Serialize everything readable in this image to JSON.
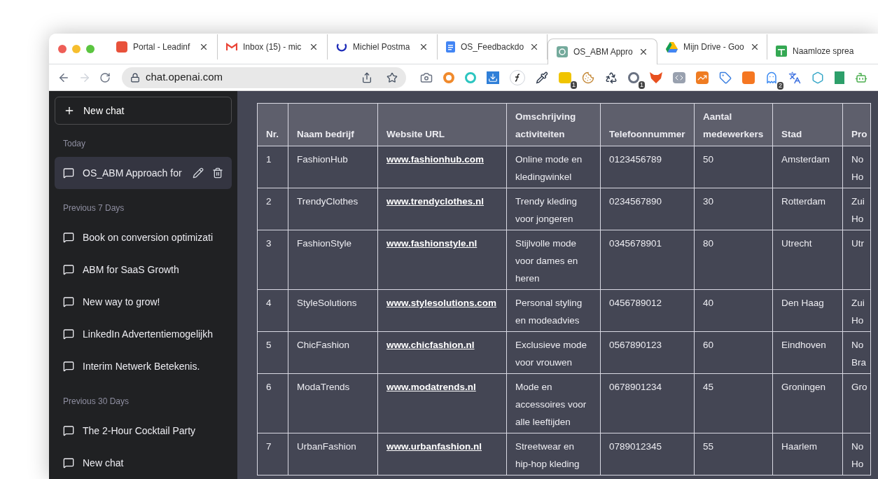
{
  "tabs": [
    {
      "title": "Portal - Leadinf",
      "selected": false
    },
    {
      "title": "Inbox (15) - mic",
      "selected": false
    },
    {
      "title": "Michiel Postma",
      "selected": false
    },
    {
      "title": "OS_Feedbackdo",
      "selected": false
    },
    {
      "title": "OS_ABM Appro",
      "selected": true
    },
    {
      "title": "Mijn Drive - Goo",
      "selected": false
    },
    {
      "title": "Naamloze sprea",
      "selected": false
    }
  ],
  "address": {
    "url": "chat.openai.com"
  },
  "extensions": [
    {
      "kind": "camera"
    },
    {
      "kind": "orange-ring"
    },
    {
      "kind": "teal-ring"
    },
    {
      "kind": "download"
    },
    {
      "kind": "formula"
    },
    {
      "kind": "dropper"
    },
    {
      "kind": "yellow",
      "badge": "1"
    },
    {
      "kind": "cookie"
    },
    {
      "kind": "recycle"
    },
    {
      "kind": "grey-ring",
      "badge": "1"
    },
    {
      "kind": "fox"
    },
    {
      "kind": "code"
    },
    {
      "kind": "chart"
    },
    {
      "kind": "tag"
    },
    {
      "kind": "hubspot"
    },
    {
      "kind": "ghost",
      "badge": "2"
    },
    {
      "kind": "translate"
    },
    {
      "kind": "web"
    },
    {
      "kind": "s-logo"
    },
    {
      "kind": "robot"
    }
  ],
  "sidebar": {
    "new_chat": "New chat",
    "sections": [
      {
        "heading": "Today",
        "items": [
          {
            "title": "OS_ABM Approach for",
            "selected": true
          }
        ]
      },
      {
        "heading": "Previous 7 Days",
        "items": [
          {
            "title": "Book on conversion optimizati",
            "selected": false
          },
          {
            "title": "ABM for SaaS Growth",
            "selected": false
          },
          {
            "title": "New way to grow!",
            "selected": false
          },
          {
            "title": "LinkedIn Advertentiemogelijkh",
            "selected": false
          },
          {
            "title": "Interim Netwerk Betekenis.",
            "selected": false
          }
        ]
      },
      {
        "heading": "Previous 30 Days",
        "items": [
          {
            "title": "The 2-Hour Cocktail Party",
            "selected": false
          },
          {
            "title": "New chat",
            "selected": false
          }
        ]
      }
    ]
  },
  "table": {
    "columns": [
      "Nr.",
      "Naam bedrijf",
      "Website URL",
      "Omschrijving activiteiten",
      "Telefoonnummer",
      "Aantal medewerkers",
      "Stad",
      "Pro"
    ],
    "rows": [
      [
        "1",
        "FashionHub",
        "www.fashionhub.com",
        "Online mode en kledingwinkel",
        "0123456789",
        "50",
        "Amsterdam",
        "No Ho"
      ],
      [
        "2",
        "TrendyClothes",
        "www.trendyclothes.nl",
        "Trendy kleding voor jongeren",
        "0234567890",
        "30",
        "Rotterdam",
        "Zui Ho"
      ],
      [
        "3",
        "FashionStyle",
        "www.fashionstyle.nl",
        "Stijlvolle mode voor dames en heren",
        "0345678901",
        "80",
        "Utrecht",
        "Utr"
      ],
      [
        "4",
        "StyleSolutions",
        "www.stylesolutions.com",
        "Personal styling en modeadvies",
        "0456789012",
        "40",
        "Den Haag",
        "Zui Ho"
      ],
      [
        "5",
        "ChicFashion",
        "www.chicfashion.nl",
        "Exclusieve mode voor vrouwen",
        "0567890123",
        "60",
        "Eindhoven",
        "No Bra"
      ],
      [
        "6",
        "ModaTrends",
        "www.modatrends.nl",
        "Mode en accessoires voor alle leeftijden",
        "0678901234",
        "45",
        "Groningen",
        "Gro"
      ],
      [
        "7",
        "UrbanFashion",
        "www.urbanfashion.nl",
        "Streetwear en hip-hop kleding",
        "0789012345",
        "55",
        "Haarlem",
        "No Ho"
      ]
    ]
  }
}
